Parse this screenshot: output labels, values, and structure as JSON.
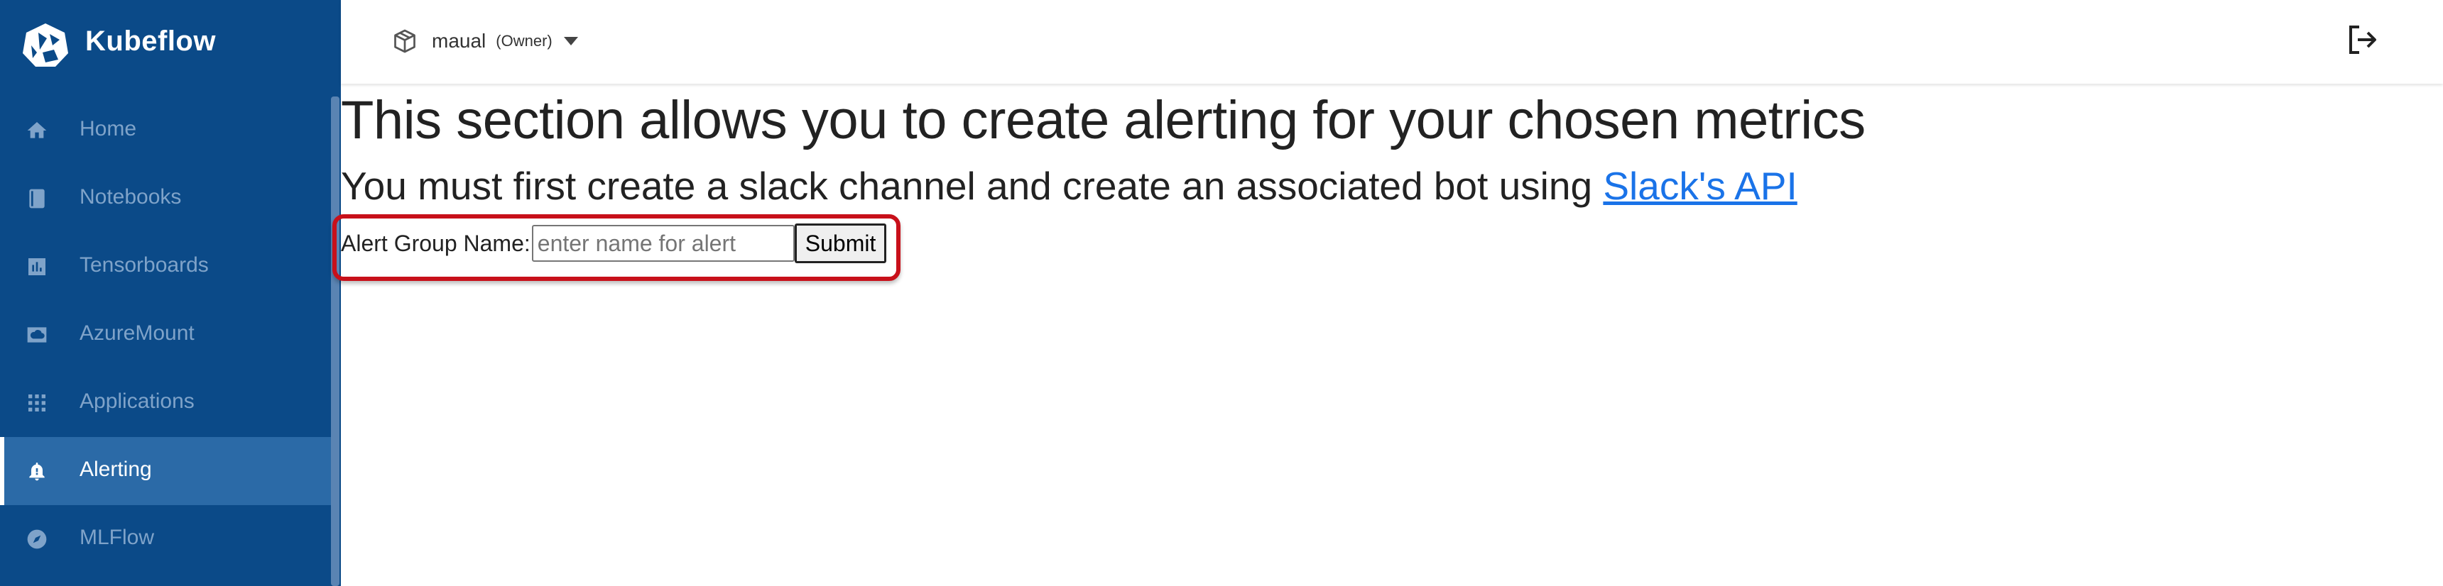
{
  "brand": {
    "name": "Kubeflow"
  },
  "sidebar": {
    "items": [
      {
        "label": "Home",
        "icon": "home-icon",
        "active": false
      },
      {
        "label": "Notebooks",
        "icon": "notebook-icon",
        "active": false
      },
      {
        "label": "Tensorboards",
        "icon": "bar-chart-icon",
        "active": false
      },
      {
        "label": "AzureMount",
        "icon": "cloud-storage-icon",
        "active": false
      },
      {
        "label": "Applications",
        "icon": "apps-grid-icon",
        "active": false
      },
      {
        "label": "Alerting",
        "icon": "bell-alert-icon",
        "active": true
      },
      {
        "label": "MLFlow",
        "icon": "compass-icon",
        "active": false
      }
    ]
  },
  "topbar": {
    "namespace": "maual",
    "role": "(Owner)"
  },
  "main": {
    "title": "This section allows you to create alerting for your chosen metrics",
    "subtitle_prefix": "You must first create a slack channel and create an associated bot using ",
    "subtitle_link": "Slack's API",
    "form": {
      "label": "Alert Group Name:",
      "input_value": "",
      "input_placeholder": "enter name for alert",
      "submit_label": "Submit"
    }
  },
  "colors": {
    "sidebar_bg": "#0b4a88",
    "sidebar_active_bg": "#2b6aa7",
    "sidebar_inactive_text": "#7fa3c9",
    "link": "#1a73e8",
    "highlight_border": "#c8101a"
  }
}
